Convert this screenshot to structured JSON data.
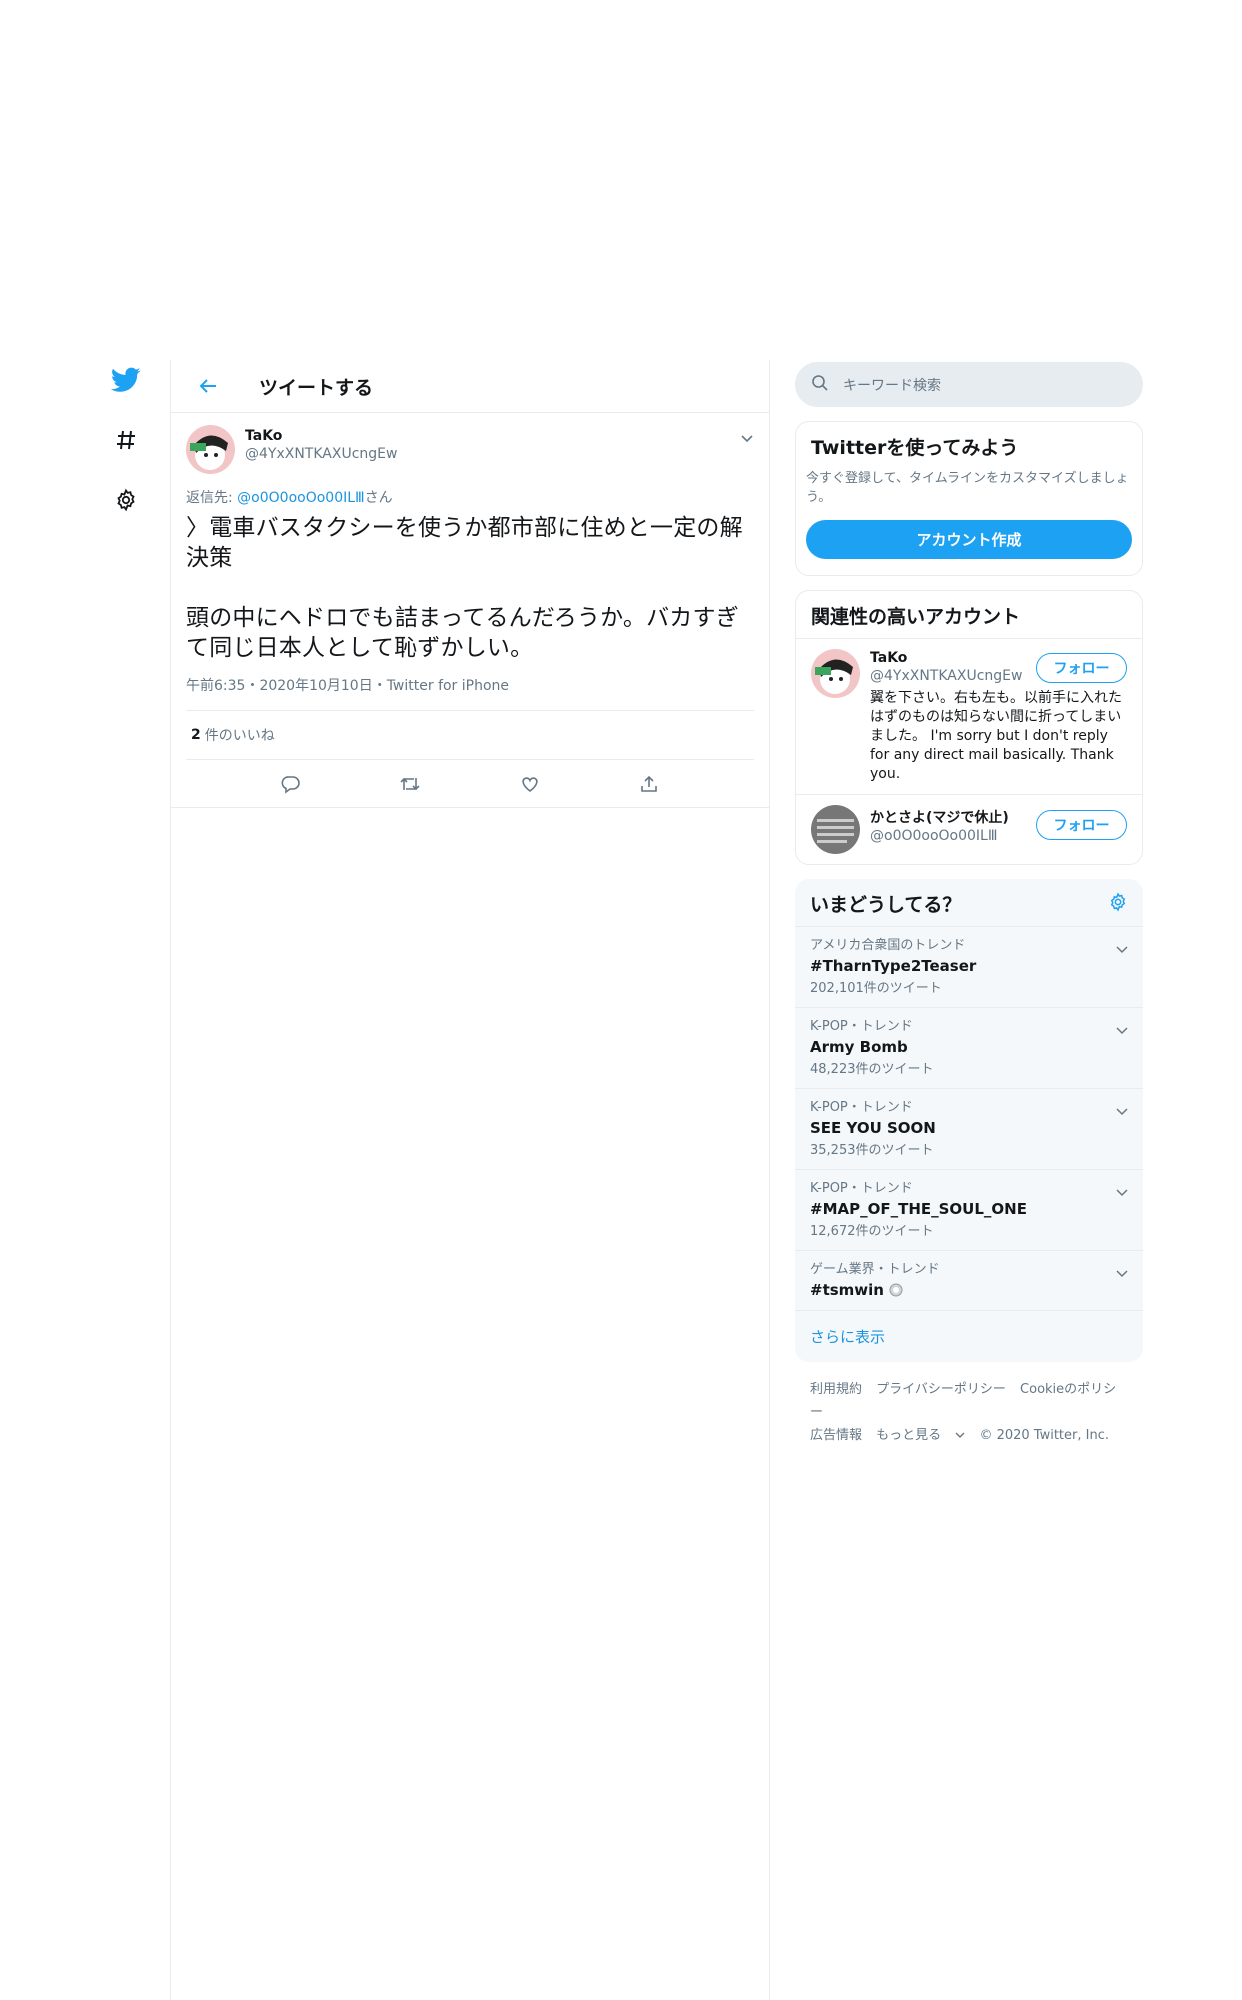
{
  "nav": {
    "items": [
      "twitter-bird",
      "explore-hashtag",
      "settings-gear"
    ]
  },
  "header": {
    "title": "ツイートする"
  },
  "tweet": {
    "author_name": "TaKo",
    "author_handle": "@4YxXNTKAXUcngEw",
    "reply_prefix": "返信先: ",
    "reply_mention": "@o0O0ooOo00ILⅢ",
    "reply_suffix": "さん",
    "text": "〉電車バスタクシーを使うか都市部に住めと一定の解決策\n\n頭の中にヘドロでも詰まってるんだろうか。バカすぎて同じ日本人として恥ずかしい。",
    "meta": "午前6:35・2020年10月10日・Twitter for iPhone",
    "likes_count": "2",
    "likes_label": "件のいいね"
  },
  "search": {
    "placeholder": "キーワード検索"
  },
  "signup": {
    "title": "Twitterを使ってみよう",
    "subtitle": "今すぐ登録して、タイムラインをカスタマイズしましょう。",
    "button": "アカウント作成"
  },
  "related": {
    "title": "関連性の高いアカウント",
    "accounts": [
      {
        "name": "TaKo",
        "handle": "@4YxXNTKAXUcngEw",
        "bio": "翼を下さい。右も左も。以前手に入れたはずのものは知らない間に折ってしまいました。 I'm sorry but I don't reply for any direct mail basically. Thank you.",
        "follow": "フォロー"
      },
      {
        "name": "かとさよ(マジで休止)",
        "handle": "@o0O0ooOo00ILⅢ",
        "bio": "",
        "follow": "フォロー"
      }
    ]
  },
  "trends": {
    "title": "いまどうしてる？",
    "items": [
      {
        "context": "アメリカ合衆国のトレンド",
        "name": "#TharnType2Teaser",
        "count": "202,101件のツイート"
      },
      {
        "context": "K-POP・トレンド",
        "name": "Army Bomb",
        "count": "48,223件のツイート"
      },
      {
        "context": "K-POP・トレンド",
        "name": "SEE YOU SOON",
        "count": "35,253件のツイート"
      },
      {
        "context": "K-POP・トレンド",
        "name": "#MAP_OF_THE_SOUL_ONE",
        "count": "12,672件のツイート"
      },
      {
        "context": "ゲーム業界・トレンド",
        "name": "#tsmwin",
        "count": ""
      }
    ],
    "show_more": "さらに表示"
  },
  "footer": {
    "links": [
      "利用規約",
      "プライバシーポリシー",
      "Cookieのポリシー",
      "広告情報",
      "もっと見る",
      "© 2020 Twitter, Inc."
    ]
  },
  "colors": {
    "accent": "#1da1f2",
    "link": "#1b95e0",
    "muted": "#657786",
    "border": "#e6ecf0"
  }
}
